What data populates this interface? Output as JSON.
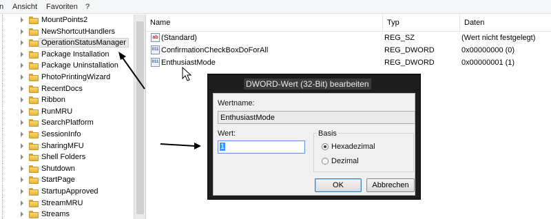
{
  "menu": {
    "items": [
      "n",
      "Ansicht",
      "Favoriten",
      "?"
    ]
  },
  "tree": {
    "items": [
      {
        "label": "MountPoints2",
        "selected": false
      },
      {
        "label": "NewShortcutHandlers",
        "selected": false
      },
      {
        "label": "OperationStatusManager",
        "selected": true
      },
      {
        "label": "Package Installation",
        "selected": false
      },
      {
        "label": "Package Uninstallation",
        "selected": false
      },
      {
        "label": "PhotoPrintingWizard",
        "selected": false
      },
      {
        "label": "RecentDocs",
        "selected": false
      },
      {
        "label": "Ribbon",
        "selected": false
      },
      {
        "label": "RunMRU",
        "selected": false
      },
      {
        "label": "SearchPlatform",
        "selected": false
      },
      {
        "label": "SessionInfo",
        "selected": false
      },
      {
        "label": "SharingMFU",
        "selected": false
      },
      {
        "label": "Shell Folders",
        "selected": false
      },
      {
        "label": "Shutdown",
        "selected": false
      },
      {
        "label": "StartPage",
        "selected": false
      },
      {
        "label": "StartupApproved",
        "selected": false
      },
      {
        "label": "StreamMRU",
        "selected": false
      },
      {
        "label": "Streams",
        "selected": false
      }
    ]
  },
  "values": {
    "columns": [
      "Name",
      "Typ",
      "Daten"
    ],
    "rows": [
      {
        "icon": "ab",
        "name": "(Standard)",
        "type": "REG_SZ",
        "data": "(Wert nicht festgelegt)"
      },
      {
        "icon": "011",
        "name": "ConfirmationCheckBoxDoForAll",
        "type": "REG_DWORD",
        "data": "0x00000000 (0)"
      },
      {
        "icon": "011",
        "name": "EnthusiastMode",
        "type": "REG_DWORD",
        "data": "0x00000001 (1)"
      }
    ]
  },
  "dialog": {
    "title": "DWORD-Wert (32-Bit) bearbeiten",
    "name_label": "Wertname:",
    "name_value": "EnthusiastMode",
    "value_label": "Wert:",
    "value_value": "1",
    "base_label": "Basis",
    "radio_hex": "Hexadezimal",
    "radio_dec": "Dezimal",
    "selected_base": "Hexadezimal",
    "ok": "OK",
    "cancel": "Abbrechen"
  },
  "colors": {
    "dialog_frame": "#1d1d1d",
    "selection_highlight": "#3399ff",
    "folder": "#e6b53a"
  },
  "icons": {
    "string_value": "registry-string-icon",
    "dword_value": "registry-dword-icon",
    "folder": "folder-icon",
    "expander": "chevron-right-icon",
    "pointer": "mouse-cursor-icon"
  }
}
